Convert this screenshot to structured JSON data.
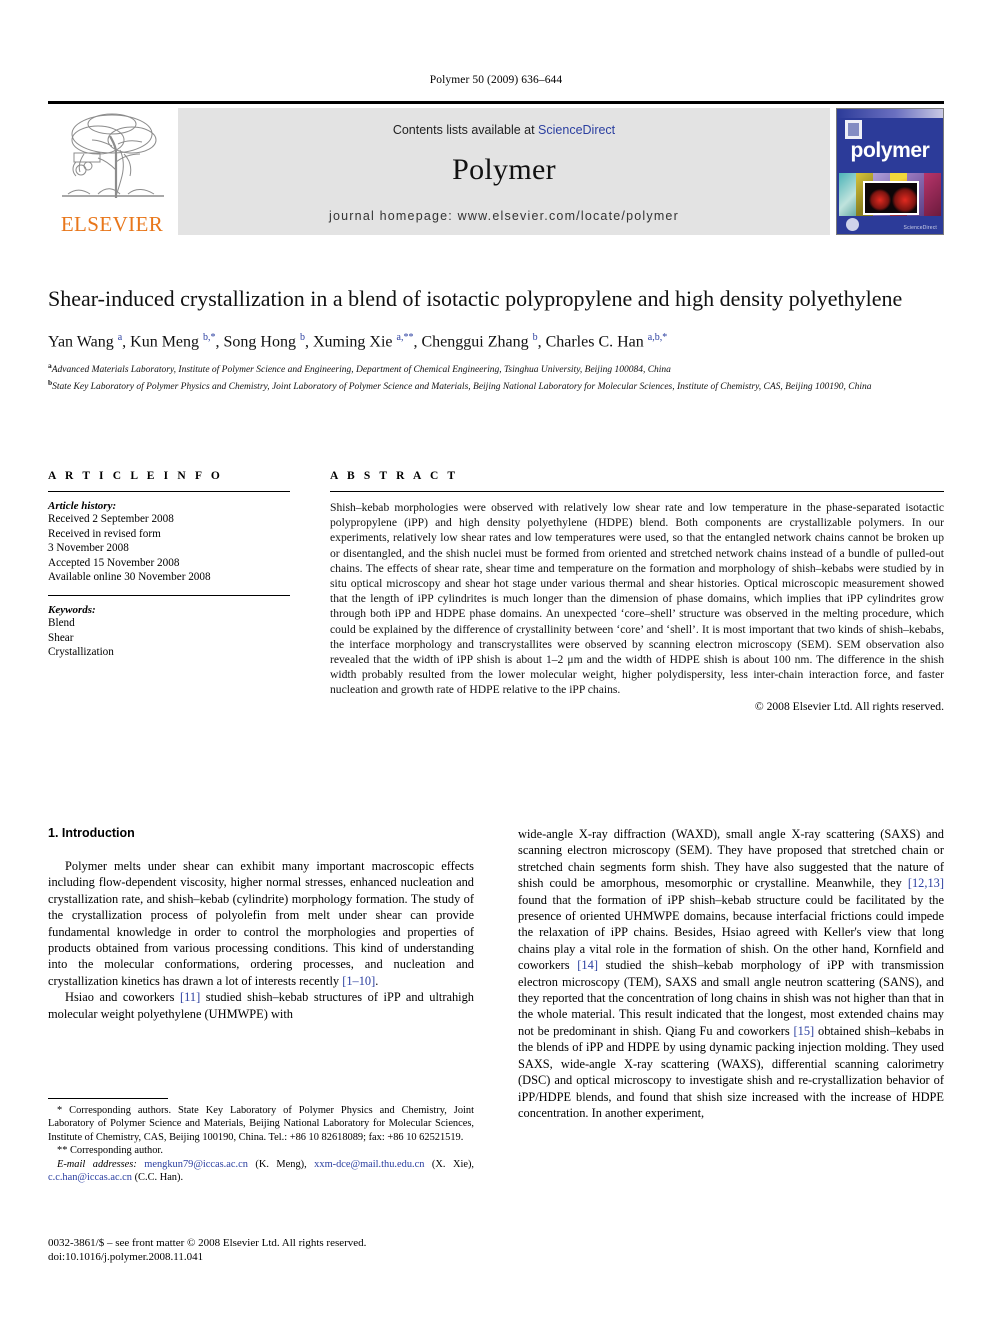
{
  "running_head": "Polymer 50 (2009) 636–644",
  "masthead": {
    "contents_prefix": "Contents lists available at ",
    "sciencedirect": "ScienceDirect",
    "journal_title": "Polymer",
    "homepage": "journal homepage: www.elsevier.com/locate/polymer",
    "publisher_word": "ELSEVIER",
    "cover_title": "polymer",
    "cover_footer": "ScienceDirect",
    "accent_link_color": "#2b3fa0",
    "elsevier_orange": "#e8761a",
    "cover_blue": "#2c3b99"
  },
  "article": {
    "title": "Shear-induced crystallization in a blend of isotactic polypropylene and high density polyethylene",
    "authors_html": "Yan Wang <sup>a</sup>, Kun Meng <sup>b,*</sup>, Song Hong <sup>b</sup>, Xuming Xie <sup>a,**</sup>, Chenggui Zhang <sup>b</sup>, Charles C. Han <sup>a,b,*</sup>",
    "affiliation_a": "Advanced Materials Laboratory, Institute of Polymer Science and Engineering, Department of Chemical Engineering, Tsinghua University, Beijing 100084, China",
    "affiliation_b": "State Key Laboratory of Polymer Physics and Chemistry, Joint Laboratory of Polymer Science and Materials, Beijing National Laboratory for Molecular Sciences, Institute of Chemistry, CAS, Beijing 100190, China"
  },
  "article_info": {
    "heading": "A R T I C L E   I N F O",
    "history_label": "Article history:",
    "history": [
      "Received 2 September 2008",
      "Received in revised form",
      "3 November 2008",
      "Accepted 15 November 2008",
      "Available online 30 November 2008"
    ],
    "keywords_label": "Keywords:",
    "keywords": [
      "Blend",
      "Shear",
      "Crystallization"
    ]
  },
  "abstract": {
    "heading": "A B S T R A C T",
    "text": "Shish–kebab morphologies were observed with relatively low shear rate and low temperature in the phase-separated isotactic polypropylene (iPP) and high density polyethylene (HDPE) blend. Both components are crystallizable polymers. In our experiments, relatively low shear rates and low temperatures were used, so that the entangled network chains cannot be broken up or disentangled, and the shish nuclei must be formed from oriented and stretched network chains instead of a bundle of pulled-out chains. The effects of shear rate, shear time and temperature on the formation and morphology of shish–kebabs were studied by in situ optical microscopy and shear hot stage under various thermal and shear histories. Optical microscopic measurement showed that the length of iPP cylindrites is much longer than the dimension of phase domains, which implies that iPP cylindrites grow through both iPP and HDPE phase domains. An unexpected ‘core–shell’ structure was observed in the melting procedure, which could be explained by the difference of crystallinity between ‘core’ and ‘shell’. It is most important that two kinds of shish–kebabs, the interface morphology and transcrystallites were observed by scanning electron microscopy (SEM). SEM observation also revealed that the width of iPP shish is about 1–2 μm and the width of HDPE shish is about 100 nm. The difference in the shish width probably resulted from the lower molecular weight, higher polydispersity, less inter-chain interaction force, and faster nucleation and growth rate of HDPE relative to the iPP chains.",
    "copyright": "© 2008 Elsevier Ltd. All rights reserved."
  },
  "intro": {
    "heading": "1. Introduction",
    "left_p1": "Polymer melts under shear can exhibit many important macroscopic effects including flow-dependent viscosity, higher normal stresses, enhanced nucleation and crystallization rate, and shish–kebab (cylindrite) morphology formation. The study of the crystallization process of polyolefin from melt under shear can provide fundamental knowledge in order to control the morphologies and properties of products obtained from various processing conditions. This kind of understanding into the molecular conformations, ordering processes, and nucleation and crystallization kinetics has drawn a lot of interests recently ",
    "left_p1_ref": "[1–10]",
    "left_p1_end": ".",
    "left_p2_a": "Hsiao and coworkers ",
    "left_p2_ref": "[11]",
    "left_p2_b": " studied shish–kebab structures of iPP and ultrahigh molecular weight polyethylene (UHMWPE) with",
    "right_p1_a": "wide-angle X-ray diffraction (WAXD), small angle X-ray scattering (SAXS) and scanning electron microscopy (SEM). They have proposed that stretched chain or stretched chain segments form shish. They have also suggested that the nature of shish could be amorphous, mesomorphic or crystalline. Meanwhile, they ",
    "right_p1_ref": "[12,13]",
    "right_p1_b": " found that the formation of iPP shish–kebab structure could be facilitated by the presence of oriented UHMWPE domains, because interfacial frictions could impede the relaxation of iPP chains. Besides, Hsiao agreed with Keller's view that long chains play a vital role in the formation of shish. On the other hand, Kornfield and coworkers ",
    "right_p1_ref2": "[14]",
    "right_p1_c": " studied the shish–kebab morphology of iPP with transmission electron microscopy (TEM), SAXS and small angle neutron scattering (SANS), and they reported that the concentration of long chains in shish was not higher than that in the whole material. This result indicated that the longest, most extended chains may not be predominant in shish. Qiang Fu and coworkers ",
    "right_p1_ref3": "[15]",
    "right_p1_d": " obtained shish–kebabs in the blends of iPP and HDPE by using dynamic packing injection molding. They used SAXS, wide-angle X-ray scattering (WAXS), differential scanning calorimetry (DSC) and optical microscopy to investigate shish and re-crystallization behavior of iPP/HDPE blends, and found that shish size increased with the increase of HDPE concentration. In another experiment,"
  },
  "footnotes": {
    "star_line": "* Corresponding authors. State Key Laboratory of Polymer Physics and Chemistry, Joint Laboratory of Polymer Science and Materials, Beijing National Laboratory for Molecular Sciences, Institute of Chemistry, CAS, Beijing 100190, China. Tel.: +86 10 82618089; fax: +86 10 62521519.",
    "dstar_line": "** Corresponding author.",
    "email_label": "E-mail addresses:",
    "email1": "mengkun79@iccas.ac.cn",
    "email1_owner": " (K. Meng), ",
    "email2": "xxm-dce@mail.thu.edu.cn",
    "email2_owner": " (X. Xie), ",
    "email3": "c.c.han@iccas.ac.cn",
    "email3_owner": " (C.C. Han)."
  },
  "imprint": {
    "issn_line": "0032-3861/$ – see front matter © 2008 Elsevier Ltd. All rights reserved.",
    "doi_line": "doi:10.1016/j.polymer.2008.11.041"
  }
}
